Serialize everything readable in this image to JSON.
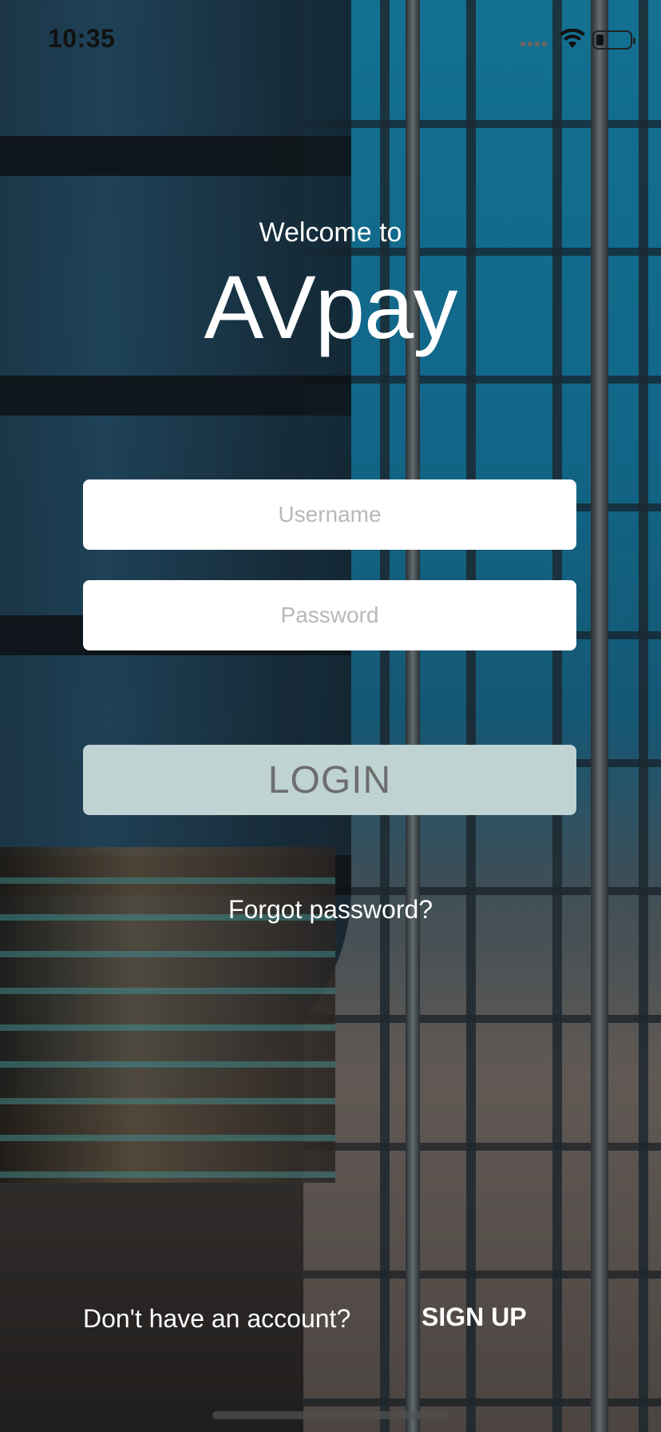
{
  "status_bar": {
    "time": "10:35",
    "icons": [
      "signal-icon",
      "wifi-icon",
      "battery-icon"
    ],
    "text_color": "#111111"
  },
  "header": {
    "welcome_text": "Welcome to",
    "app_name": "AVpay"
  },
  "form": {
    "username_placeholder": "Username",
    "username_value": "",
    "password_placeholder": "Password",
    "password_value": ""
  },
  "actions": {
    "login_label": "LOGIN",
    "login_button_color": "#bfd3d2",
    "forgot_password": "Forgot password?"
  },
  "footer": {
    "prompt": "Don't have an account?",
    "signup_label": "SIGN UP"
  }
}
